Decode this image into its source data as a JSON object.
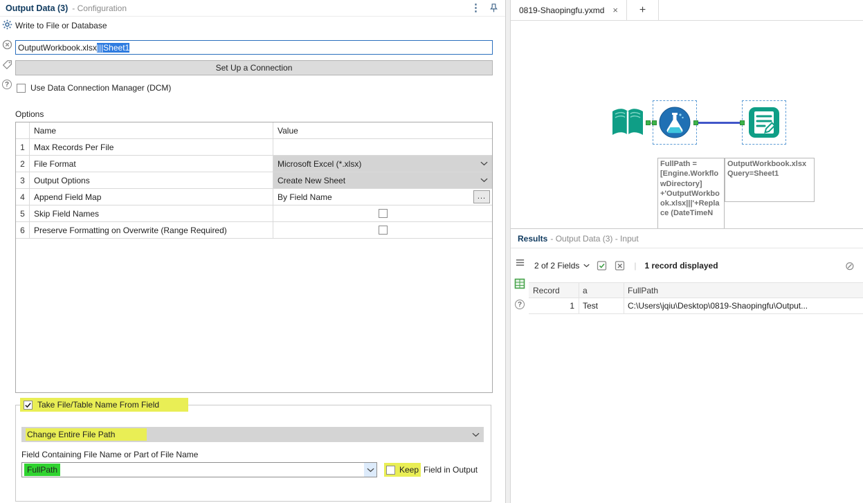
{
  "icons": {
    "menu": "⋮",
    "help": "?",
    "ellipsis": "...",
    "no_limit": "⊘",
    "close_tab": "×",
    "new_tab": "+"
  },
  "config": {
    "title": "Output Data (3)",
    "subtitle": "- Configuration",
    "write_label": "Write to File or Database",
    "file_value_plain": "OutputWorkbook.xlsx",
    "file_value_selected": "|||Sheet1",
    "setup_button": "Set Up a Connection",
    "dcm_label": "Use Data Connection Manager (DCM)",
    "options_label": "Options",
    "table": {
      "col_name": "Name",
      "col_value": "Value",
      "rows": [
        {
          "num": "1",
          "name": "Max Records Per File",
          "value": ""
        },
        {
          "num": "2",
          "name": "File Format",
          "value": "Microsoft Excel (*.xlsx)"
        },
        {
          "num": "3",
          "name": "Output Options",
          "value": "Create New Sheet"
        },
        {
          "num": "4",
          "name": "Append Field Map",
          "value": "By Field Name"
        },
        {
          "num": "5",
          "name": "Skip Field Names",
          "value": ""
        },
        {
          "num": "6",
          "name": "Preserve Formatting on Overwrite (Range Required)",
          "value": ""
        }
      ]
    },
    "take_file_label": "Take File/Table Name From Field",
    "path_mode_value": "Change Entire File Path",
    "field_label": "Field Containing File Name or Part of File Name",
    "field_value": "FullPath",
    "keep_highlight": "Keep",
    "keep_rest": "Field in Output"
  },
  "canvas": {
    "tab_title": "0819-Shaopingfu.yxmd",
    "annotation_formula": "FullPath = [Engine.WorkflowDirectory] +'OutputWorkbook.xlsx|||'+Replace (DateTimeN",
    "annotation_output_line1": "OutputWorkbook.xlsx",
    "annotation_output_line2": "Query=Sheet1"
  },
  "results": {
    "title": "Results",
    "subtitle": "- Output Data (3) - Input",
    "fields_summary": "2 of 2 Fields",
    "records_summary": "1 record displayed",
    "table": {
      "headers": [
        "Record",
        "a",
        "FullPath"
      ],
      "row": {
        "record": "1",
        "a": "Test",
        "fullpath": "C:\\Users\\jqiu\\Desktop\\0819-Shaopingfu\\Output..."
      }
    }
  }
}
